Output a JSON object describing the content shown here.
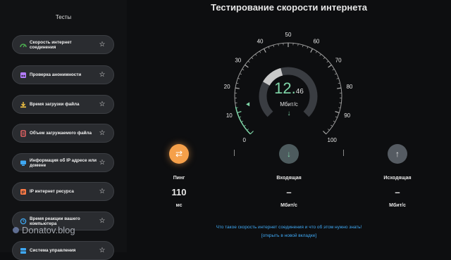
{
  "sidebar": {
    "title": "Тесты",
    "items": [
      {
        "label": "Скорость интернет соединения",
        "icon": "speedometer-icon",
        "icon_color": "#4caf50"
      },
      {
        "label": "Проверка анонимности",
        "icon": "incognito-icon",
        "icon_color": "#b57cff"
      },
      {
        "label": "Время загрузки файла",
        "icon": "download-icon",
        "icon_color": "#f5c542"
      },
      {
        "label": "Объем загружаемого файла",
        "icon": "file-size-icon",
        "icon_color": "#ff6b6b"
      },
      {
        "label": "Информация об IP адресе или домене",
        "icon": "ip-info-icon",
        "icon_color": "#3fa9f5"
      },
      {
        "label": "IP интернет ресурса",
        "icon": "ip-resource-icon",
        "icon_color": "#ff7a45"
      },
      {
        "label": "Время реакции вашего компьютера",
        "icon": "reaction-time-icon",
        "icon_color": "#3fa9f5"
      },
      {
        "label": "Система управления",
        "icon": "cms-icon",
        "icon_color": "#3fa9f5"
      }
    ],
    "star_glyph": "☆"
  },
  "watermark": "Donatov.blog",
  "main": {
    "title": "Тестирование скорости интернета"
  },
  "gauge": {
    "ticks": [
      "0",
      "10",
      "20",
      "30",
      "40",
      "50",
      "60",
      "70",
      "80",
      "90",
      "100"
    ],
    "value_main": "12.",
    "value_fraction": "46",
    "value": 12.46,
    "unit": "Мбит/с",
    "arrow_glyph": "↓",
    "accent_color": "#7fd6a8"
  },
  "stats": {
    "ping": {
      "label": "Пинг",
      "value": "110",
      "unit": "мс",
      "icon": "ping-icon",
      "icon_glyph": "⇄",
      "color": "#f5a04a"
    },
    "download": {
      "label": "Входящая",
      "value": "–",
      "unit": "Мбит/с",
      "icon": "download-arrow-icon",
      "icon_glyph": "↓",
      "color": "#5a6b6e"
    },
    "upload": {
      "label": "Исходящая",
      "value": "–",
      "unit": "Мбит/с",
      "icon": "upload-arrow-icon",
      "icon_glyph": "↑",
      "color": "#5a6066"
    }
  },
  "info": {
    "line1": "Что такое скорость интернет соединения и что об этом нужно знать!",
    "line2": "[открыть в новой вкладке]"
  }
}
